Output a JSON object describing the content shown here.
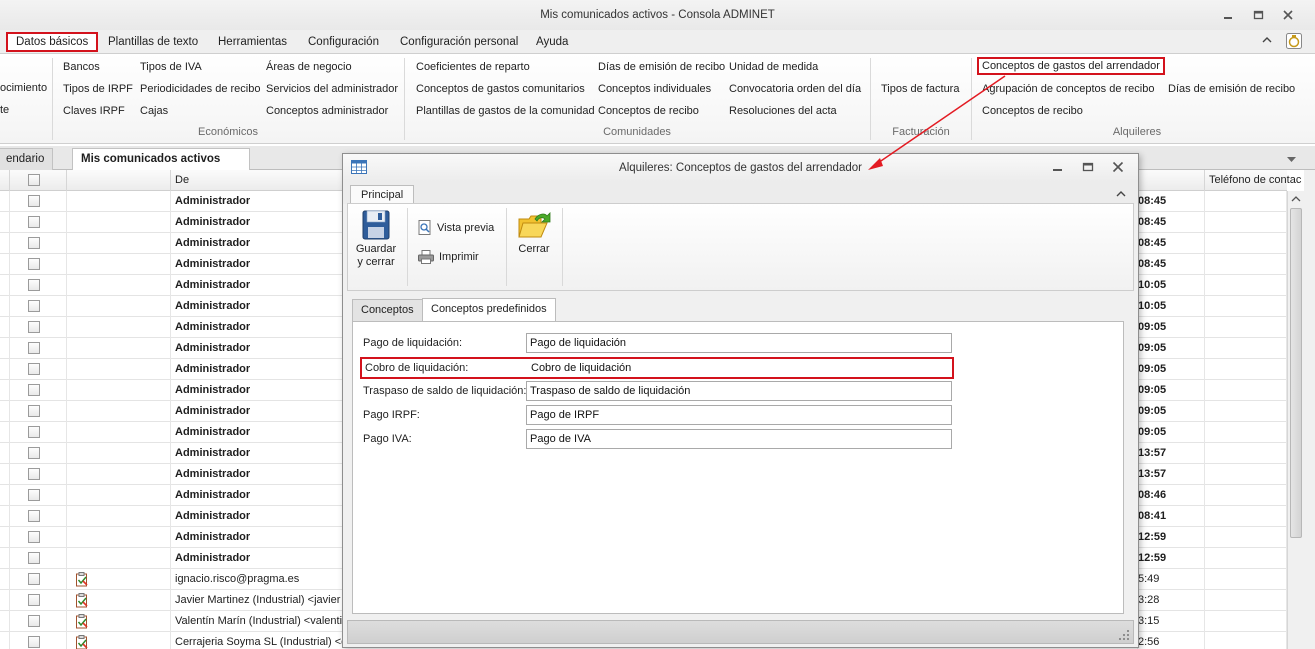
{
  "window": {
    "title": "Mis comunicados activos - Consola ADMINET"
  },
  "ribbon_tabs": [
    "Datos básicos",
    "Plantillas de texto",
    "Herramientas",
    "Configuración",
    "Configuración personal",
    "Ayuda"
  ],
  "ribbon": {
    "partial_left": [
      "ocimiento",
      "te"
    ],
    "economicos": {
      "label": "Económicos",
      "col1": [
        "Bancos",
        "Tipos de IRPF",
        "Claves IRPF"
      ],
      "col2": [
        "Tipos de IVA",
        "Periodicidades de recibo",
        "Cajas"
      ],
      "col3": [
        "Áreas de negocio",
        "Servicios del administrador",
        "Conceptos administrador"
      ]
    },
    "comunidades": {
      "label": "Comunidades",
      "col1": [
        "Coeficientes de reparto",
        "Conceptos de gastos comunitarios",
        "Plantillas de gastos de la comunidad"
      ],
      "col2": [
        "Días de emisión de recibo",
        "Conceptos individuales",
        "Conceptos de recibo"
      ],
      "col3": [
        "Unidad de medida",
        "Convocatoria orden del día",
        "Resoluciones del acta"
      ]
    },
    "facturacion": {
      "label": "Facturación",
      "items": [
        "Tipos de factura"
      ]
    },
    "alquileres": {
      "label": "Alquileres",
      "col1": [
        "Conceptos de gastos del arrendador",
        "Agrupación de conceptos de recibo",
        "Conceptos de recibo"
      ],
      "col2": [
        "Días de emisión de recibo"
      ]
    }
  },
  "doc_tabs": {
    "partial": "endario",
    "active": "Mis comunicados activos",
    "close": "✕"
  },
  "grid": {
    "headers": [
      "",
      "",
      "De",
      "",
      "Teléfono de contac"
    ],
    "rows": [
      {
        "from": "Administrador",
        "time": "08:45",
        "bold": true,
        "icon": false
      },
      {
        "from": "Administrador",
        "time": "08:45",
        "bold": true,
        "icon": false
      },
      {
        "from": "Administrador",
        "time": "08:45",
        "bold": true,
        "icon": false
      },
      {
        "from": "Administrador",
        "time": "08:45",
        "bold": true,
        "icon": false
      },
      {
        "from": "Administrador",
        "time": "10:05",
        "bold": true,
        "icon": false
      },
      {
        "from": "Administrador",
        "time": "10:05",
        "bold": true,
        "icon": false
      },
      {
        "from": "Administrador",
        "time": "09:05",
        "bold": true,
        "icon": false
      },
      {
        "from": "Administrador",
        "time": "09:05",
        "bold": true,
        "icon": false
      },
      {
        "from": "Administrador",
        "time": "09:05",
        "bold": true,
        "icon": false
      },
      {
        "from": "Administrador",
        "time": "09:05",
        "bold": true,
        "icon": false
      },
      {
        "from": "Administrador",
        "time": "09:05",
        "bold": true,
        "icon": false
      },
      {
        "from": "Administrador",
        "time": "09:05",
        "bold": true,
        "icon": false
      },
      {
        "from": "Administrador",
        "time": "13:57",
        "bold": true,
        "icon": false
      },
      {
        "from": "Administrador",
        "time": "13:57",
        "bold": true,
        "icon": false
      },
      {
        "from": "Administrador",
        "time": "08:46",
        "bold": true,
        "icon": false
      },
      {
        "from": "Administrador",
        "time": "08:41",
        "bold": true,
        "icon": false
      },
      {
        "from": "Administrador",
        "time": "12:59",
        "bold": true,
        "icon": false
      },
      {
        "from": "Administrador",
        "time": "12:59",
        "bold": true,
        "icon": false
      },
      {
        "from": "ignacio.risco@pragma.es",
        "time": "5:49",
        "bold": false,
        "icon": true
      },
      {
        "from": "Javier Martinez (Industrial) <javier",
        "time": "3:28",
        "bold": false,
        "icon": true
      },
      {
        "from": "Valentín Marín (Industrial) <valenti",
        "time": "3:15",
        "bold": false,
        "icon": true
      },
      {
        "from": "Cerrajeria Soyma SL (Industrial) <c",
        "time": "2:56",
        "bold": false,
        "icon": true
      }
    ]
  },
  "dialog": {
    "title": "Alquileres: Conceptos de gastos del arrendador",
    "tab": "Principal",
    "buttons": {
      "save": "Guardar\ny cerrar",
      "save_line1": "Guardar",
      "save_line2": "y cerrar",
      "preview": "Vista previa",
      "print": "Imprimir",
      "close": "Cerrar"
    },
    "inner_tabs": [
      "Conceptos",
      "Conceptos predefinidos"
    ],
    "fields": [
      {
        "label": "Pago de liquidación:",
        "value": "Pago de liquidación"
      },
      {
        "label": "Cobro de liquidación:",
        "value": "Cobro de liquidación"
      },
      {
        "label": "Traspaso de saldo de liquidación:",
        "value": "Traspaso de saldo de liquidación"
      },
      {
        "label": "Pago IRPF:",
        "value": "Pago de IRPF"
      },
      {
        "label": "Pago IVA:",
        "value": "Pago de IVA"
      }
    ]
  },
  "colors": {
    "highlight": "#d3121c",
    "arrow": "#e31b23"
  }
}
